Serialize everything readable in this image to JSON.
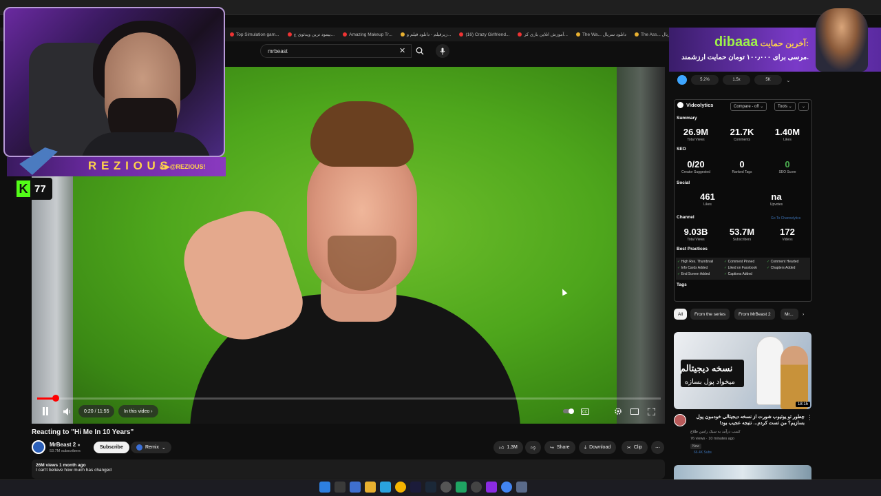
{
  "browser": {
    "bookmarks": [
      "Top Simulation gam...",
      "بیمود ترین ویدئوی ج...",
      "Amazing Makeup Tr...",
      "زیرفیلم - دانلود فیلم و...",
      "(16) Crazy Girlfriend...",
      "آموزش انلاین بازی کر...",
      "The Wa... دانلود سریال",
      "The Ass... دانلود سریال"
    ]
  },
  "search": {
    "query": "mrbeast"
  },
  "player": {
    "time": "0:20 / 11:55",
    "in_this_video": "In this video",
    "progress_fraction": 0.028
  },
  "video": {
    "title": "Reacting to \"Hi Me In 10 Years\"",
    "channel": "MrBeast 2",
    "subscribers": "53.7M subscribers",
    "subscribe": "Subscribe",
    "remix": "Remix",
    "likes": "1.3M",
    "share": "Share",
    "download": "Download",
    "clip": "Clip",
    "views_date": "26M views  1 month ago",
    "description": "I can't believe how much has changed"
  },
  "stream": {
    "name": "R E Z I O U S",
    "handle": "@REZIOUS!",
    "kick_count": "77"
  },
  "donation": {
    "prefix": "آخرین حمایت:",
    "name": "dibaaa",
    "message": "مرسی برای ۱۰۰٫۰۰۰ تومان حمایت ارزشمند."
  },
  "stats_bar": [
    "5.2%",
    "1.5x",
    "5K"
  ],
  "videolytics": {
    "title": "Videolytics",
    "compare": "Compare - off",
    "tools": "Tools",
    "summary_label": "Summary",
    "summary": [
      {
        "value": "26.9M",
        "label": "Total Views"
      },
      {
        "value": "21.7K",
        "label": "Comments"
      },
      {
        "value": "1.40M",
        "label": "Likes"
      }
    ],
    "seo_label": "SEO",
    "seo": [
      {
        "value": "0/20",
        "label": "Creator Suggested"
      },
      {
        "value": "0",
        "label": "Ranked Tags"
      },
      {
        "value": "0",
        "label": "SEO Score"
      }
    ],
    "social_label": "Social",
    "social": [
      {
        "value": "461",
        "label": "Likes"
      },
      {
        "value": "na",
        "label": "Upvotes"
      }
    ],
    "channel_label": "Channel",
    "channel_link": "Go To Channelytics",
    "channel": [
      {
        "value": "9.03B",
        "label": "Total Views"
      },
      {
        "value": "53.7M",
        "label": "Subscribers"
      },
      {
        "value": "172",
        "label": "Videos"
      }
    ],
    "best_practices_label": "Best Practices",
    "best_practices": [
      "High Res. Thumbnail",
      "Comment Pinned",
      "Comment Hearted",
      "Info Cards Added",
      "Liked on Facebook",
      "Chapters Added",
      "End Screen Added",
      "Captions Added"
    ],
    "tags_label": "Tags"
  },
  "chips": [
    "All",
    "From the series",
    "From MrBeast 2",
    "Mr..."
  ],
  "recommended": {
    "thumb_text_1": "نسخه دیجیتالم",
    "thumb_text_2": "میخواد پول بسازه",
    "duration": "18:15",
    "title": "چطور تو یوتیوب شورت از نسخه دیجیتالی خودمون پول بسازیم؟ من تست کردم... نتیجه عجیب بود!",
    "channel": "کسب درآمد به سبک رامین طلاع",
    "meta": "76 views · 10 minutes ago",
    "badge": "New",
    "extra": "66.4K Subs"
  }
}
